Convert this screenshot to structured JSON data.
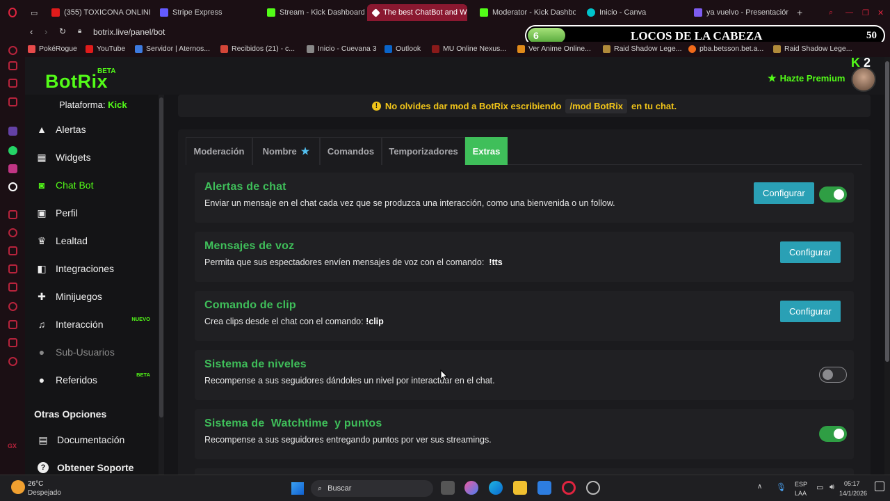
{
  "browser": {
    "tabs": [
      {
        "label": "(355) TOXICONA ONLINE",
        "color": "#e01b1b"
      },
      {
        "label": "Stripe Express",
        "color": "#635bff"
      },
      {
        "label": "Stream - Kick Dashboard",
        "color": "#53fc18"
      },
      {
        "label": "The best ChatBot and Wid",
        "color": "#ffffff"
      },
      {
        "label": "Moderator - Kick Dashbo",
        "color": "#53fc18"
      },
      {
        "label": "Inicio - Canva",
        "color": "#00c4cc"
      },
      {
        "label": "ya vuelvo - Presentación",
        "color": "#7d5cf0"
      }
    ],
    "url": "botrix.live/panel/bot",
    "bookmarks": [
      "PokéRogue",
      "YouTube",
      "Servidor | Aternos...",
      "Recibidos (21) - c...",
      "Inicio - Cuevana 3",
      "Outlook",
      "MU Online Nexus...",
      "Ver Anime Online...",
      "Raid Shadow Lege...",
      "pba.betsson.bet.a...",
      "Raid Shadow Lege..."
    ],
    "profile_letter": "C"
  },
  "overlay": {
    "level": "6",
    "title": "LOCOS DE LA CABEZA",
    "count": "50"
  },
  "header": {
    "logo": "BotRix",
    "logo_badge": "BETA",
    "premium": "Hazte Premium",
    "badge_count": "2"
  },
  "sidebar": {
    "platform_label": "Plataforma:",
    "platform_value": "Kick",
    "items": [
      {
        "label": "Alertas",
        "icon": "warning-icon"
      },
      {
        "label": "Widgets",
        "icon": "grid-icon"
      },
      {
        "label": "Chat Bot",
        "icon": "android-icon"
      },
      {
        "label": "Perfil",
        "icon": "profile-icon"
      },
      {
        "label": "Lealtad",
        "icon": "trophy-icon"
      },
      {
        "label": "Integraciones",
        "icon": "integration-icon"
      },
      {
        "label": "Minijuegos",
        "icon": "gamepad-icon"
      },
      {
        "label": "Interacción",
        "icon": "music-icon",
        "badge": "NUEVO"
      },
      {
        "label": "Sub-Usuarios",
        "icon": "users-icon"
      },
      {
        "label": "Referidos",
        "icon": "users-icon",
        "badge": "BETA"
      }
    ],
    "section_title": "Otras Opciones",
    "other_items": [
      {
        "label": "Documentación",
        "icon": "book-icon"
      },
      {
        "label": "Obtener Soporte",
        "icon": "question-icon"
      }
    ]
  },
  "notice": {
    "before": "No olvides dar mod a BotRix escribiendo",
    "code": "/mod BotRix",
    "after": "en tu chat."
  },
  "tabs": [
    "Moderación",
    "Nombre",
    "Comandos",
    "Temporizadores",
    "Extras"
  ],
  "features": [
    {
      "title": "Alertas de chat",
      "desc": "Enviar un mensaje en el chat cada vez que se produzca una interacción, como una bienvenida o un follow.",
      "button": "Configurar",
      "toggle": "on"
    },
    {
      "title": "Mensajes de voz",
      "desc": "Permita que sus espectadores envíen mensajes de voz con el comando:",
      "cmd": "!tts",
      "button": "Configurar"
    },
    {
      "title": "Comando de clip",
      "desc": "Crea clips desde el chat con el comando:",
      "cmd": "!clip",
      "button": "Configurar"
    },
    {
      "title": "Sistema de niveles",
      "desc": "Recompense a sus seguidores dándoles un nivel por interactuar en el chat.",
      "toggle": "off"
    },
    {
      "title": "Sistema de  Watchtime  y puntos",
      "desc": "Recompense a sus seguidores entregando puntos por ver sus streamings.",
      "toggle": "on"
    }
  ],
  "taskbar": {
    "weather_temp": "26°C",
    "weather_desc": "Despejado",
    "search": "Buscar",
    "lang1": "ESP",
    "lang2": "LAA",
    "time": "05:17",
    "date": "14/1/2026"
  },
  "colors": {
    "accent": "#53fc18",
    "green": "#3fbf5a",
    "button": "#2aa0b5",
    "warning": "#f0c419"
  }
}
